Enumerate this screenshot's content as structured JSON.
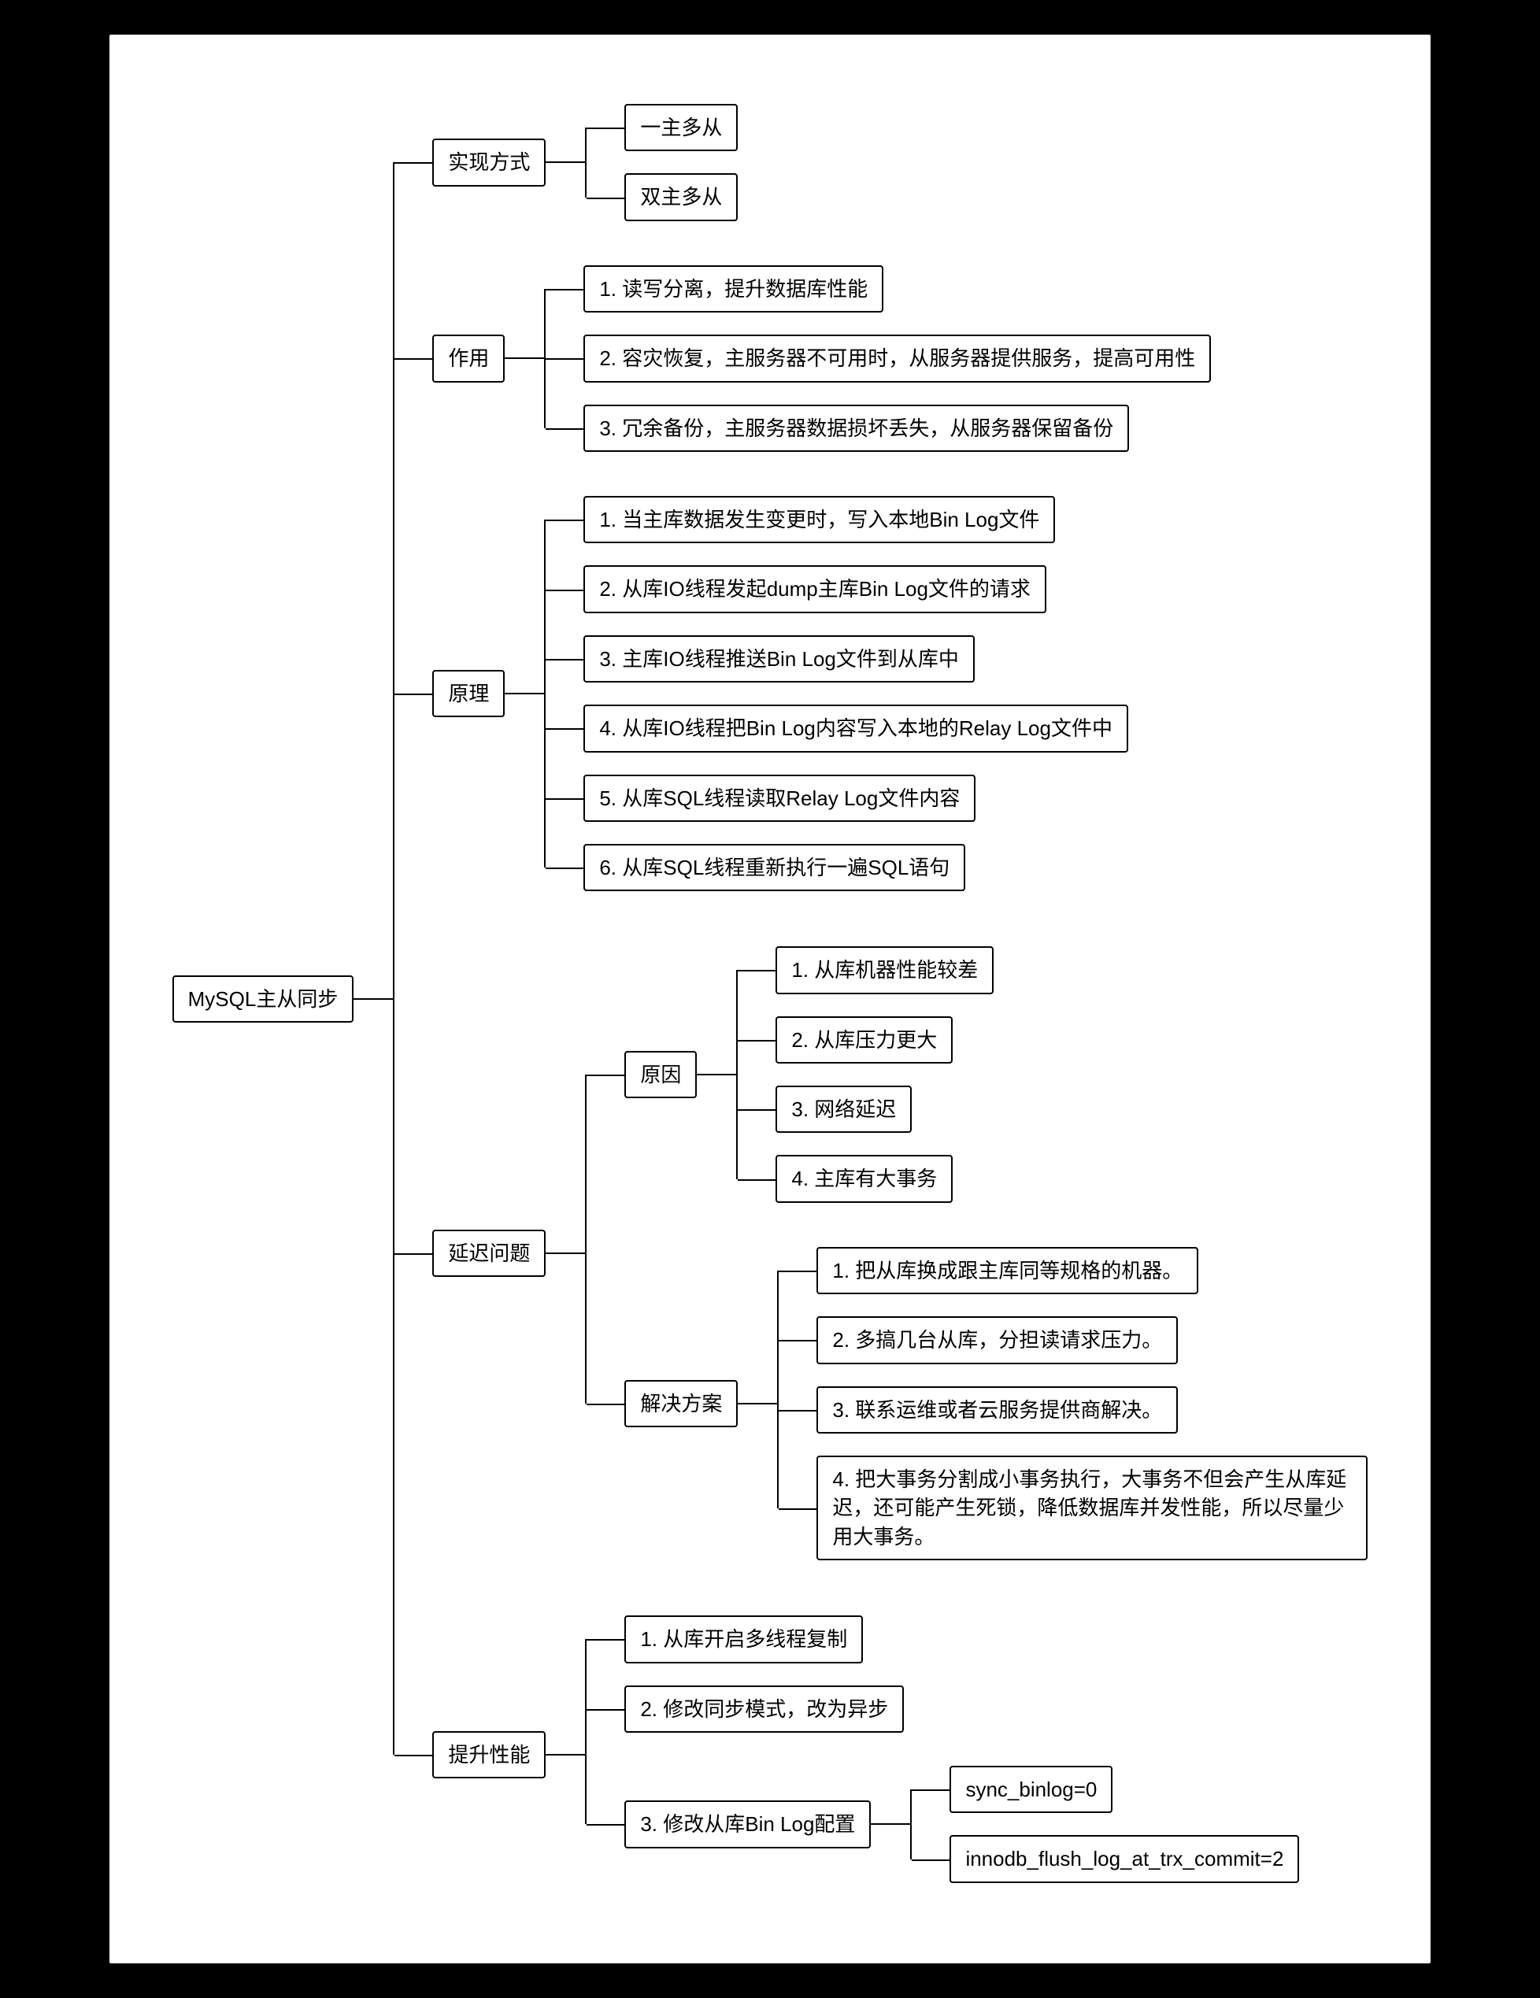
{
  "root": {
    "label": "MySQL主从同步"
  },
  "implementation": {
    "label": "实现方式",
    "items": [
      "一主多从",
      "双主多从"
    ]
  },
  "purpose": {
    "label": "作用",
    "items": [
      "1. 读写分离，提升数据库性能",
      "2. 容灾恢复，主服务器不可用时，从服务器提供服务，提高可用性",
      "3. 冗余备份，主服务器数据损坏丢失，从服务器保留备份"
    ]
  },
  "principle": {
    "label": "原理",
    "items": [
      "1. 当主库数据发生变更时，写入本地Bin Log文件",
      "2. 从库IO线程发起dump主库Bin Log文件的请求",
      "3. 主库IO线程推送Bin Log文件到从库中",
      "4. 从库IO线程把Bin Log内容写入本地的Relay Log文件中",
      "5. 从库SQL线程读取Relay Log文件内容",
      "6. 从库SQL线程重新执行一遍SQL语句"
    ]
  },
  "delay": {
    "label": "延迟问题",
    "cause": {
      "label": "原因",
      "items": [
        "1. 从库机器性能较差",
        "2. 从库压力更大",
        "3. 网络延迟",
        "4. 主库有大事务"
      ]
    },
    "solution": {
      "label": "解决方案",
      "items": [
        "1. 把从库换成跟主库同等规格的机器。",
        "2. 多搞几台从库，分担读请求压力。",
        "3. 联系运维或者云服务提供商解决。",
        "4. 把大事务分割成小事务执行，大事务不但会产生从库延迟，还可能产生死锁，降低数据库并发性能，所以尽量少用大事务。"
      ]
    }
  },
  "performance": {
    "label": "提升性能",
    "items": [
      "1. 从库开启多线程复制",
      "2. 修改同步模式，改为异步"
    ],
    "binlog": {
      "label": "3. 修改从库Bin Log配置",
      "items": [
        "sync_binlog=0",
        "innodb_flush_log_at_trx_commit=2"
      ]
    }
  }
}
